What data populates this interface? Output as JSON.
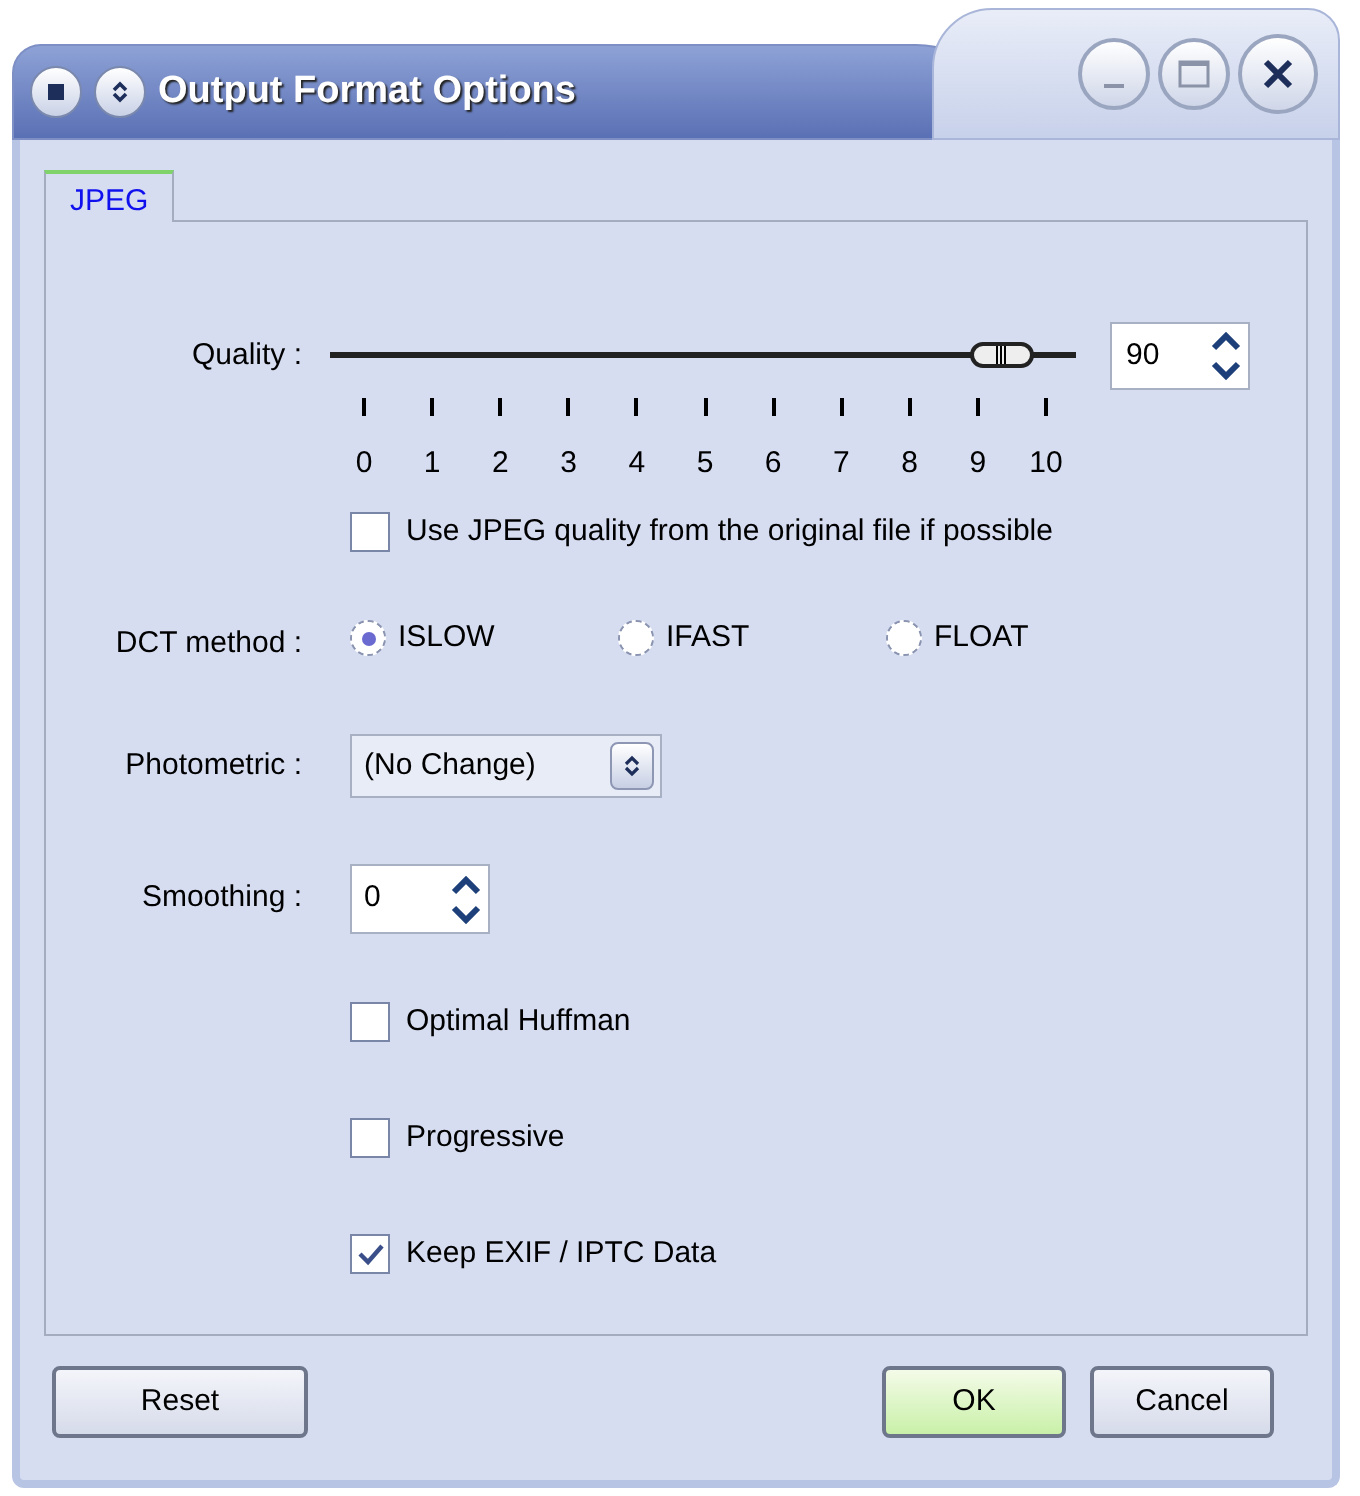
{
  "window": {
    "title": "Output Format Options"
  },
  "tabs": [
    {
      "label": "JPEG",
      "selected": true
    }
  ],
  "quality": {
    "label": "Quality :",
    "level": 0.9,
    "tick_labels": [
      "0",
      "1",
      "2",
      "3",
      "4",
      "5",
      "6",
      "7",
      "8",
      "9",
      "10"
    ],
    "value": "90"
  },
  "use_original_quality": {
    "label": "Use JPEG quality from the original file if possible",
    "checked": false
  },
  "dct_method": {
    "label": "DCT method :",
    "options": [
      {
        "label": "ISLOW",
        "selected": true
      },
      {
        "label": "IFAST",
        "selected": false
      },
      {
        "label": "FLOAT",
        "selected": false
      }
    ]
  },
  "photometric": {
    "label": "Photometric :",
    "value": "(No Change)"
  },
  "smoothing": {
    "label": "Smoothing :",
    "value": "0"
  },
  "checkboxes": [
    {
      "label": "Optimal Huffman",
      "checked": false
    },
    {
      "label": "Progressive",
      "checked": false
    },
    {
      "label": "Keep EXIF / IPTC Data",
      "checked": true
    }
  ],
  "left_buttons": [
    {
      "label": "Reset",
      "kind": "plain"
    }
  ],
  "right_buttons": [
    {
      "label": "OK",
      "kind": "default"
    },
    {
      "label": "Cancel",
      "kind": "plain"
    }
  ]
}
